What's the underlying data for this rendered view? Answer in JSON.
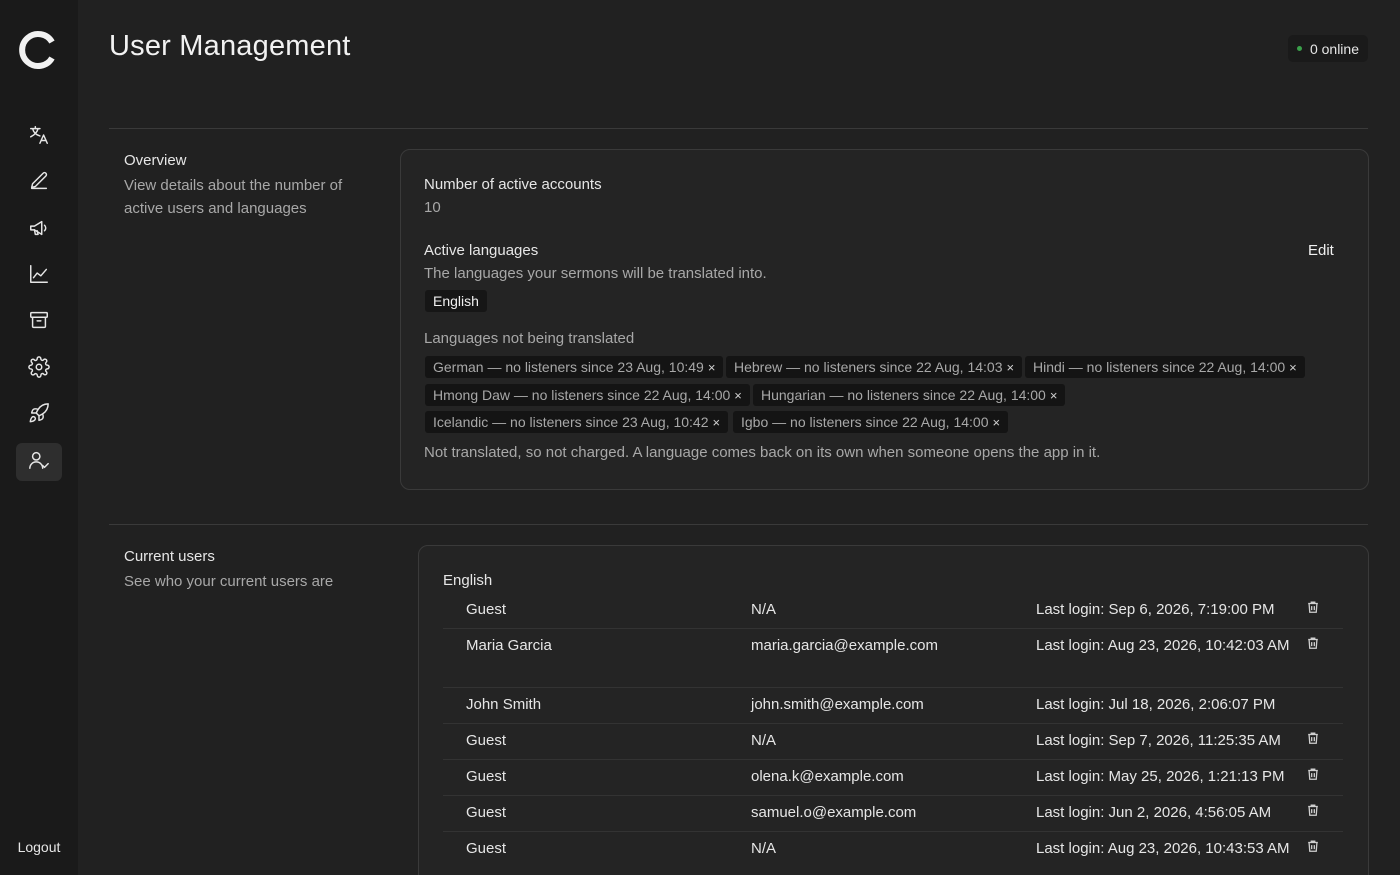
{
  "sidebar": {
    "logo": "app-logo",
    "items": [
      {
        "icon": "translate-icon",
        "active": false
      },
      {
        "icon": "pencil-icon",
        "active": false
      },
      {
        "icon": "megaphone-icon",
        "active": false
      },
      {
        "icon": "chart-line-icon",
        "active": false
      },
      {
        "icon": "archive-icon",
        "active": false
      },
      {
        "icon": "gear-icon",
        "active": false
      },
      {
        "icon": "rocket-icon",
        "active": false
      },
      {
        "icon": "user-check-icon",
        "active": true
      }
    ],
    "logout_label": "Logout"
  },
  "header": {
    "title": "User Management",
    "online_badge": "0 online",
    "online_color": "#3aa04a"
  },
  "overview": {
    "title": "Overview",
    "description": "View details about the number of active users and languages",
    "active_accounts_label": "Number of active accounts",
    "active_accounts_value": "10",
    "active_languages_label": "Active languages",
    "edit_label": "Edit",
    "active_languages_desc": "The languages your sermons will be translated into.",
    "active_languages": [
      "English"
    ],
    "not_translated_label": "Languages not being translated",
    "not_translated": [
      "German — no listeners since 23 Aug, 10:49",
      "Hebrew — no listeners since 22 Aug, 14:03",
      "Hindi — no listeners since 22 Aug, 14:00",
      "Hmong Daw — no listeners since 22 Aug, 14:00",
      "Hungarian — no listeners since 22 Aug, 14:00",
      "Icelandic — no listeners since 23 Aug, 10:42",
      "Igbo — no listeners since 22 Aug, 14:00"
    ],
    "tag_remove_glyph": "×",
    "not_translated_note": "Not translated, so not charged. A language comes back on its own when someone opens the app in it."
  },
  "current_users": {
    "title": "Current users",
    "description": "See who your current users are",
    "group_label": "English",
    "users": [
      {
        "name": "Guest",
        "email": "N/A",
        "last_login": "Last login: Sep 6, 2026, 7:19:00 PM",
        "deletable": true
      },
      {
        "name": "Maria Garcia",
        "email": "maria.garcia@example.com",
        "last_login": "Last login: Aug 23, 2026, 10:42:03 AM",
        "deletable": true
      },
      {
        "name": "John Smith",
        "email": "john.smith@example.com",
        "last_login": "Last login: Jul 18, 2026, 2:06:07 PM",
        "deletable": false
      },
      {
        "name": "Guest",
        "email": "N/A",
        "last_login": "Last login: Sep 7, 2026, 11:25:35 AM",
        "deletable": true
      },
      {
        "name": "Guest",
        "email": "olena.k@example.com",
        "last_login": "Last login: May 25, 2026, 1:21:13 PM",
        "deletable": true
      },
      {
        "name": "Guest",
        "email": "samuel.o@example.com",
        "last_login": "Last login: Jun 2, 2026, 4:56:05 AM",
        "deletable": true
      },
      {
        "name": "Guest",
        "email": "N/A",
        "last_login": "Last login: Aug 23, 2026, 10:43:53 AM",
        "deletable": true
      }
    ]
  }
}
